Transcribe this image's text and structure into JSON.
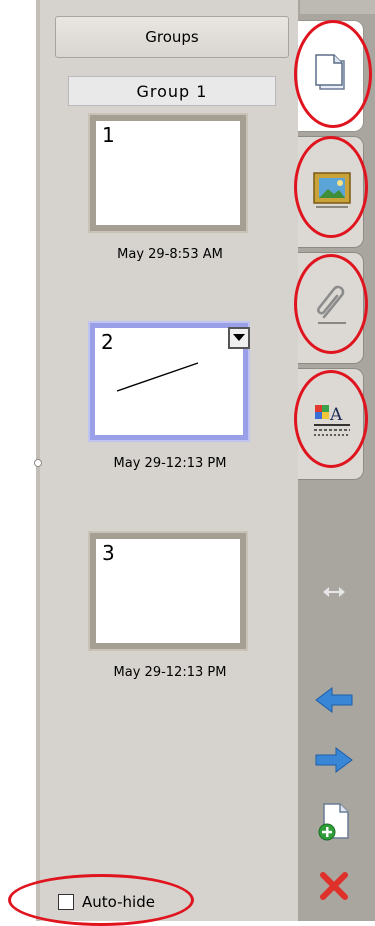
{
  "groups_button": "Groups",
  "group_label": "Group 1",
  "slides": [
    {
      "number": "1",
      "date": "May 29-8:53 AM"
    },
    {
      "number": "2",
      "date": "May 29-12:13 PM"
    },
    {
      "number": "3",
      "date": "May 29-12:13 PM"
    }
  ],
  "autohide": {
    "label": "Auto-hide",
    "checked": false
  },
  "tabs": {
    "page_sorter": "page-sorter-icon",
    "gallery": "gallery-image-icon",
    "attachments": "paperclip-icon",
    "properties": "properties-icon"
  },
  "colors": {
    "panel": "#d6d3ce",
    "sidebar": "#a9a59f",
    "highlight": "#e0141e",
    "selection": "#9aa0e8",
    "arrow_blue": "#3a86d6",
    "delete_red": "#e0302a"
  }
}
